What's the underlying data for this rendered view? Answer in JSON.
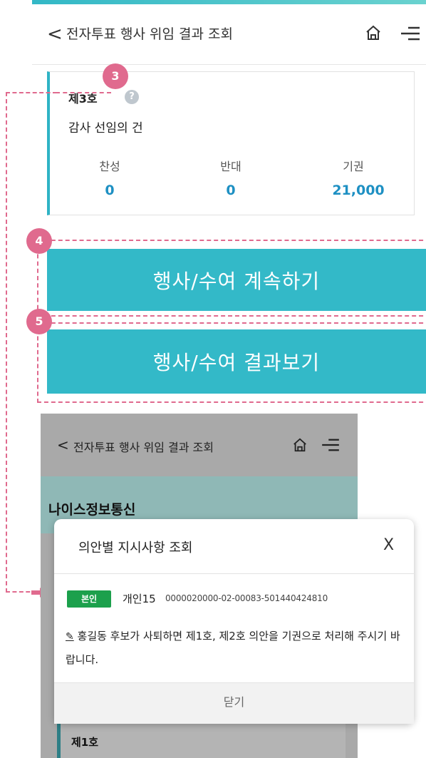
{
  "top": {
    "strip_text": "",
    "header": {
      "back": "<",
      "title": "전자투표 행사 위임 결과 조회"
    },
    "card": {
      "number": "제3호",
      "help": "?",
      "name": "감사 선임의 건",
      "votes": [
        {
          "label": "찬성",
          "value": "0"
        },
        {
          "label": "반대",
          "value": "0"
        },
        {
          "label": "기권",
          "value": "21,000"
        }
      ]
    },
    "badges": {
      "three": "3",
      "four": "4",
      "five": "5"
    },
    "buttons": {
      "continue": "행사/수여 계속하기",
      "results": "행사/수여 결과보기"
    }
  },
  "bottom": {
    "header": {
      "back": "<",
      "title": "전자투표 행사 위임 결과 조회"
    },
    "company": "나이스정보통신",
    "card_number": "제1호"
  },
  "modal": {
    "title": "의안별 지시사항 조회",
    "close_x": "X",
    "self_badge": "본인",
    "account_type": "개인15",
    "account_no": "0000020000-02-00083-501440424810",
    "note_icon": "✎",
    "note": "홍길동 후보가 사퇴하면 제1호, 제2호 의안을 기권으로 처리해 주시기 바랍니다.",
    "close_button": "닫기"
  },
  "colors": {
    "accent": "#33b9c8",
    "annotation": "#e06a8e",
    "value": "#1e90c3",
    "self_badge": "#1ca04c"
  },
  "icons": [
    "back-chevron-icon",
    "home-icon",
    "menu-icon",
    "help-icon",
    "pencil-icon",
    "close-icon"
  ]
}
